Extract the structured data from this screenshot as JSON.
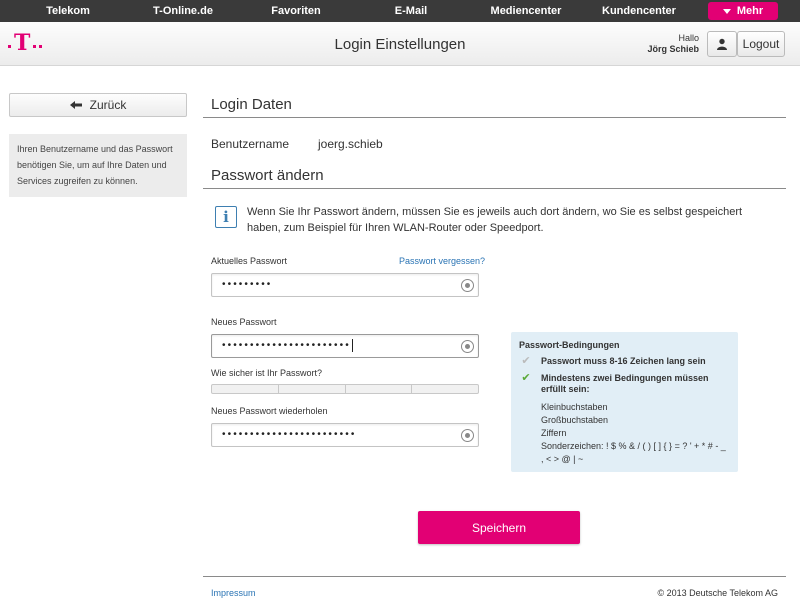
{
  "topnav": {
    "items": [
      "Telekom",
      "T-Online.de",
      "Favoriten",
      "E-Mail",
      "Mediencenter",
      "Kundencenter"
    ],
    "more_label": "Mehr"
  },
  "header": {
    "title": "Login Einstellungen",
    "greeting": "Hallo",
    "username": "Jörg Schieb",
    "logout_label": "Logout"
  },
  "sidebar": {
    "back_label": "Zurück",
    "info_text": "Ihren Benutzername und das Passwort benötigen Sie, um auf Ihre Daten und Services zugreifen zu können."
  },
  "login_section": {
    "title": "Login Daten",
    "username_label": "Benutzername",
    "username_value": "joerg.schieb"
  },
  "password_section": {
    "title": "Passwort ändern",
    "info_text": "Wenn Sie Ihr Passwort ändern, müssen Sie es jeweils auch dort ändern, wo Sie es selbst gespeichert haben, zum Beispiel für Ihren WLAN-Router oder Speedport.",
    "current_label": "Aktuelles Passwort",
    "forgot_link": "Passwort vergessen?",
    "current_value": "•••••••••",
    "new_label": "Neues Passwort",
    "new_value": "•••••••••••••••••••••••",
    "strength_label": "Wie sicher ist Ihr Passwort?",
    "repeat_label": "Neues Passwort wiederholen",
    "repeat_value": "••••••••••••••••••••••••"
  },
  "conditions": {
    "title": "Passwort-Bedingungen",
    "rule1": "Passwort muss 8-16 Zeichen lang sein",
    "rule1_met": false,
    "rule2": "Mindestens zwei Bedingungen müssen erfüllt sein:",
    "rule2_met": true,
    "sub_items": [
      "Kleinbuchstaben",
      "Großbuchstaben",
      "Ziffern",
      "Sonderzeichen: ! $ % & / ( ) [ ] { } = ? ' + * # - _ , < > @ | ~"
    ]
  },
  "actions": {
    "save_label": "Speichern"
  },
  "footer": {
    "impressum": "Impressum",
    "copyright": "© 2013 Deutsche Telekom AG"
  },
  "colors": {
    "brand": "#e20074",
    "link": "#2a74b4",
    "info_box": "#e1eef6",
    "check_met": "#5aa937"
  }
}
